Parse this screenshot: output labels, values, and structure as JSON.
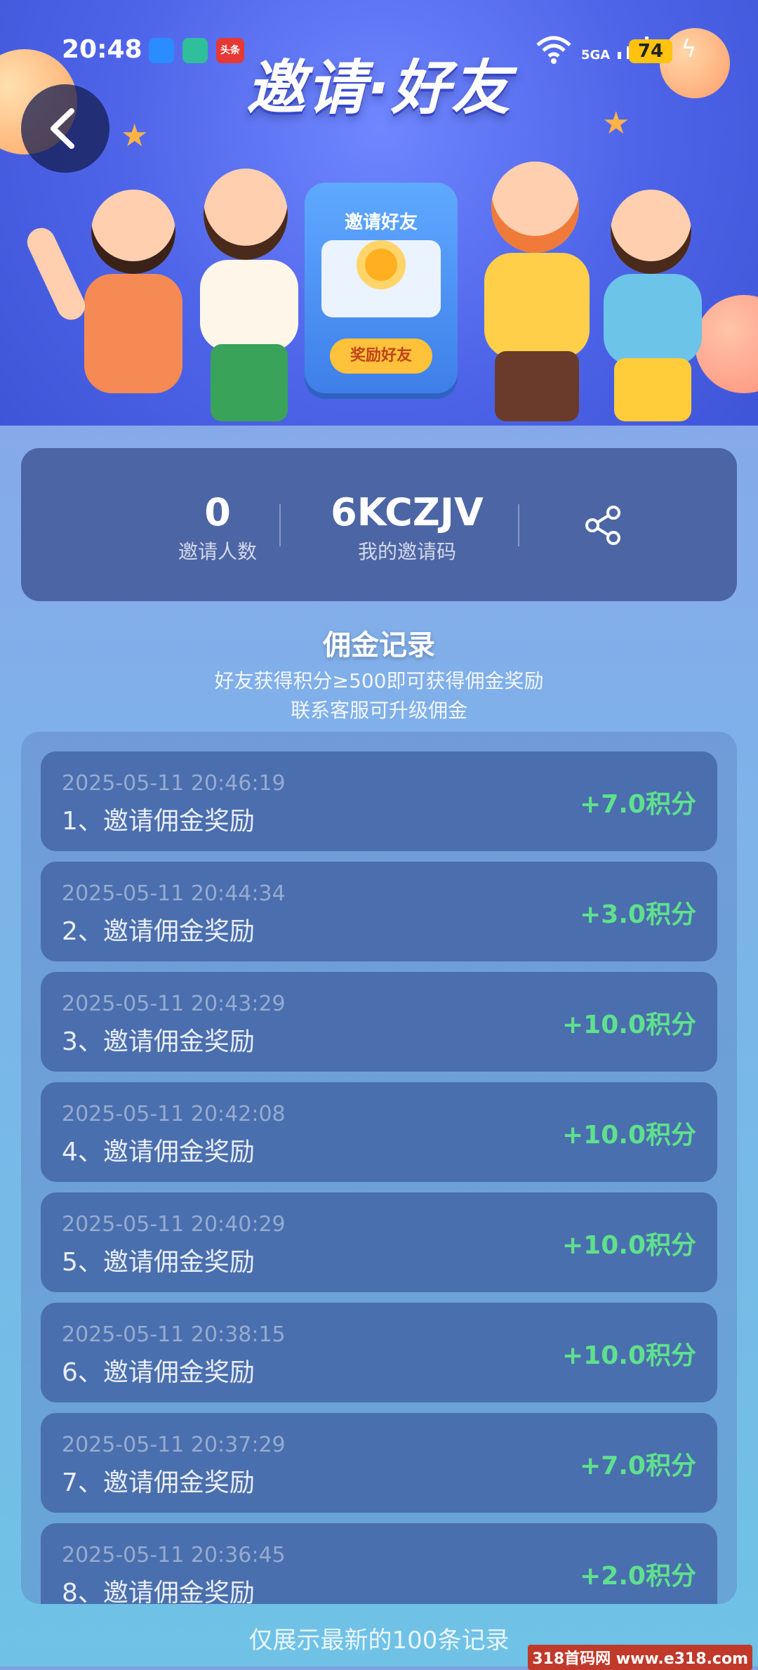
{
  "status_bar": {
    "time": "20:48",
    "network": "5GA",
    "battery": "74",
    "app_badge": "头条"
  },
  "banner": {
    "title": "邀请·好友",
    "phone_card_title": "邀请好友",
    "phone_card_button": "奖励好友"
  },
  "invite": {
    "count_value": "0",
    "count_label": "邀请人数",
    "code_value": "6KCZJV",
    "code_label": "我的邀请码"
  },
  "commission": {
    "title": "佣金记录",
    "subtitle_1": "好友获得积分≥500即可获得佣金奖励",
    "subtitle_2": "联系客服可升级佣金"
  },
  "records": [
    {
      "time": "2025-05-11 20:46:19",
      "name": "1、邀请佣金奖励",
      "amount": "+7.0积分"
    },
    {
      "time": "2025-05-11 20:44:34",
      "name": "2、邀请佣金奖励",
      "amount": "+3.0积分"
    },
    {
      "time": "2025-05-11 20:43:29",
      "name": "3、邀请佣金奖励",
      "amount": "+10.0积分"
    },
    {
      "time": "2025-05-11 20:42:08",
      "name": "4、邀请佣金奖励",
      "amount": "+10.0积分"
    },
    {
      "time": "2025-05-11 20:40:29",
      "name": "5、邀请佣金奖励",
      "amount": "+10.0积分"
    },
    {
      "time": "2025-05-11 20:38:15",
      "name": "6、邀请佣金奖励",
      "amount": "+10.0积分"
    },
    {
      "time": "2025-05-11 20:37:29",
      "name": "7、邀请佣金奖励",
      "amount": "+7.0积分"
    },
    {
      "time": "2025-05-11 20:36:45",
      "name": "8、邀请佣金奖励",
      "amount": "+2.0积分"
    }
  ],
  "footer": {
    "note": "仅展示最新的100条记录"
  },
  "watermark": "318首码网 www.e318.com",
  "colors": {
    "accent_green": "#5fe08e",
    "banner_blue": "#4e64e8",
    "battery_yellow": "#ffc20e"
  }
}
